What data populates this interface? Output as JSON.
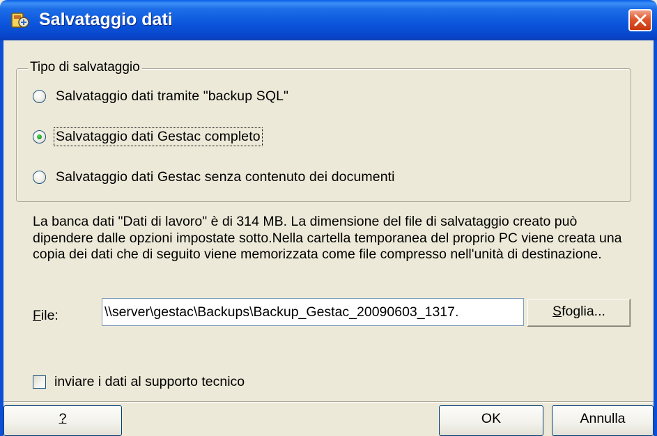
{
  "window": {
    "title": "Salvataggio dati",
    "icon": "backup-app-icon",
    "close_icon": "close-icon",
    "colors": {
      "titlebar": "#0b55dc",
      "face": "#ece9d8",
      "close_button": "#e0572d"
    }
  },
  "backup_type": {
    "legend": "Tipo di salvataggio",
    "options": [
      {
        "label": "Salvataggio dati tramite \"backup SQL\"",
        "checked": false
      },
      {
        "label": "Salvataggio dati Gestac completo",
        "checked": true
      },
      {
        "label": "Salvataggio dati Gestac senza contenuto dei documenti",
        "checked": false
      }
    ]
  },
  "info": {
    "text": "La banca dati \"Dati di lavoro\" è di 314 MB. La dimensione del file di salvataggio creato può dipendere dalle opzioni impostate sotto.Nella cartella temporanea del proprio PC viene creata una copia dei dati che di seguito viene memorizzata come file compresso nell'unità di destinazione."
  },
  "file": {
    "label_first": "F",
    "label_rest": "ile:",
    "value": "\\\\server\\gestac\\Backups\\Backup_Gestac_20090603_1317.",
    "browse_first": "S",
    "browse_rest": "foglia..."
  },
  "support": {
    "label": "inviare i dati al supporto tecnico",
    "checked": false
  },
  "buttons": {
    "help": "?",
    "ok": "OK",
    "cancel": "Annulla"
  }
}
